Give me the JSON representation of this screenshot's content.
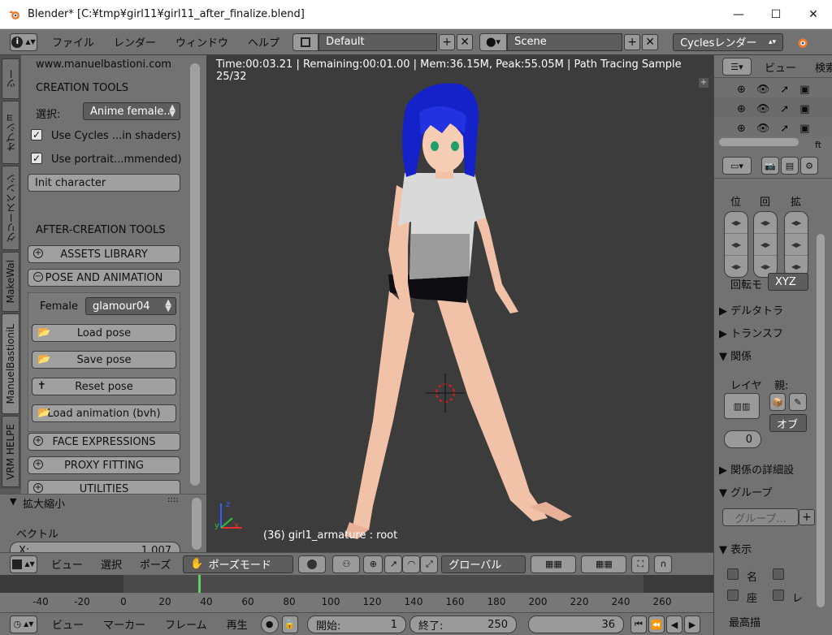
{
  "window": {
    "title": "Blender* [C:¥tmp¥girl11¥girl11_after_finalize.blend]",
    "minimize": "—",
    "maximize": "☐",
    "close": "✕"
  },
  "topbar": {
    "info_icon": "i",
    "menus": [
      "ファイル",
      "レンダー",
      "ウィンドウ",
      "ヘルプ"
    ],
    "layout": "Default",
    "scene": "Scene",
    "engine": "Cyclesレンダー"
  },
  "left_tabs": [
    "ツー",
    "オプショ",
    "グリースペンシ",
    "MakeWal",
    "ManuelBastioniL",
    "VRM HELPE"
  ],
  "tool_shelf": {
    "website": "www.manuelbastioni.com",
    "creation_heading": "CREATION TOOLS",
    "select_label": "選択:",
    "select_value": "Anime female...",
    "use_cycles": "Use Cycles ...in shaders)",
    "use_portrait": "Use portrait...mmended)",
    "init_character": "Init character",
    "after_heading": "AFTER-CREATION TOOLS",
    "assets_library": "ASSETS LIBRARY",
    "pose_animation": "POSE AND ANIMATION",
    "female_label": "Female",
    "female_value": "glamour04",
    "load_pose": "Load pose",
    "save_pose": "Save pose",
    "reset_pose": "Reset pose",
    "load_animation": "Load animation (bvh)",
    "face_expressions": "FACE EXPRESSIONS",
    "proxy_fitting": "PROXY FITTING",
    "utilities": "UTILITIES"
  },
  "lower_panel": {
    "title": "拡大縮小",
    "vector": "ベクトル",
    "x_label": "X:",
    "x_value": "1.007"
  },
  "viewport": {
    "info": "Time:00:03.21 | Remaining:00:01.00 | Mem:36.15M, Peak:55.05M | Path Tracing Sample 25/32",
    "object": "(36) girl1_armature : root"
  },
  "header3d": {
    "menus": [
      "ビュー",
      "選択",
      "ポーズ"
    ],
    "mode": "ポーズモード",
    "orientation": "グローバル"
  },
  "timeline": {
    "ticks": [
      "-40",
      "-20",
      "0",
      "20",
      "40",
      "60",
      "80",
      "100",
      "120",
      "140",
      "160",
      "180",
      "200",
      "220",
      "240",
      "260"
    ],
    "current_frame": 36
  },
  "header_bottom": {
    "menus": [
      "ビュー",
      "マーカー",
      "フレーム",
      "再生"
    ],
    "start_label": "開始:",
    "start_value": "1",
    "end_label": "終了:",
    "end_value": "250",
    "current": "36"
  },
  "outliner": {
    "view_menu": "ビュー",
    "search_label": "検索",
    "ft": "ft"
  },
  "properties": {
    "pos": "位",
    "rot": "回",
    "scale": "拡",
    "rotation_mode_label": "回転モ",
    "rotation_mode_value": "XYZ",
    "delta_transform": "デルタトラ",
    "transform": "トランスフ",
    "relations": "関係",
    "layer": "レイヤ",
    "parent": "親:",
    "object_btn": "オブ",
    "bone_group_value": "0",
    "relations_extras": "関係の詳細設",
    "groups": "グループ",
    "group_btn": "グループ...",
    "display": "表示",
    "name": "名",
    "axes": "座",
    "x_ray": "レ",
    "max_draw": "最高描"
  }
}
